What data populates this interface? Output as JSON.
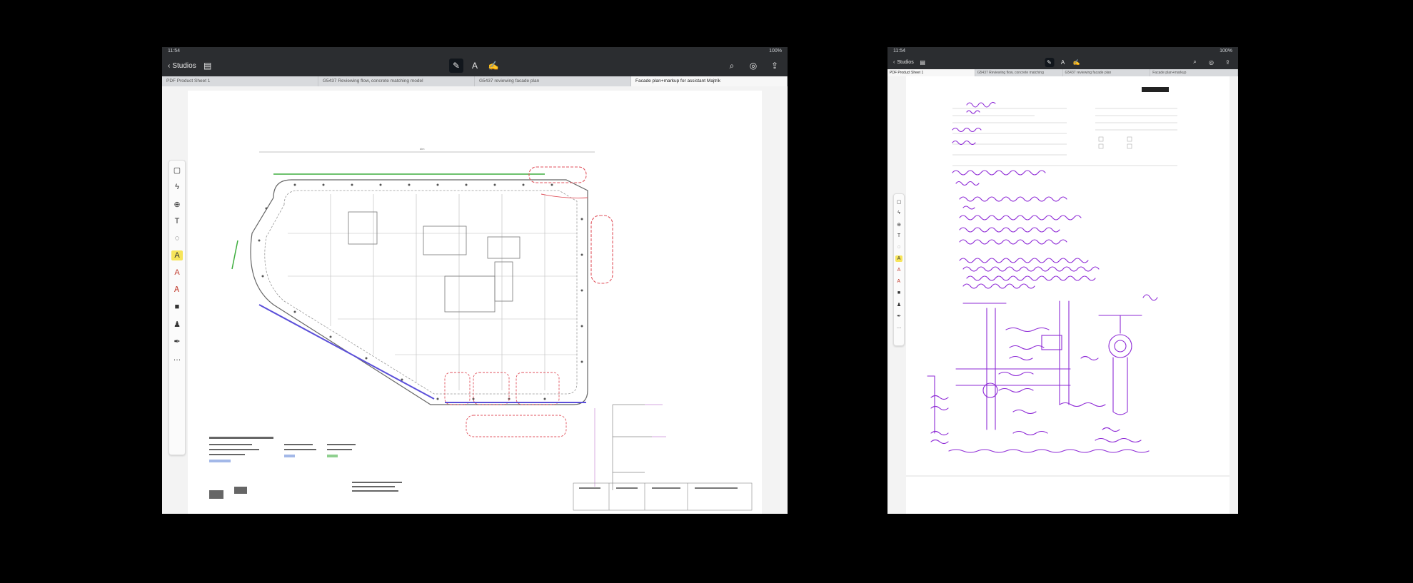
{
  "left_device": {
    "nav": {
      "back_label": "Studios"
    },
    "tabs": [
      {
        "label": "PDF Product Sheet 1",
        "active": false
      },
      {
        "label": "G5437 Reviewing flow, concrete matching model",
        "active": false
      },
      {
        "label": "G5437 reviewing facade plan",
        "active": false
      },
      {
        "label": "Facade plan+markup for assistant Majtrik",
        "active": true
      }
    ],
    "toolbar_icons": [
      "pen-icon",
      "highlighter-icon",
      "note-icon",
      "search-icon",
      "glasses-icon",
      "share-icon"
    ],
    "side_tools": [
      "select-icon",
      "lightning-icon",
      "zoom-icon",
      "text-icon",
      "shape-icon",
      "highlight-icon",
      "stamp-icon",
      "pencil-icon",
      "camera-icon",
      "person-icon",
      "marker-icon",
      "more-icon"
    ],
    "colors": {
      "green_markup": "#3fae3f",
      "red_markup": "#e0525c",
      "blue_markup": "#5b4fd9",
      "plan_line": "#555555",
      "toolbar_bg": "#2b2d30"
    }
  },
  "right_device": {
    "nav": {
      "back_label": "Studios"
    },
    "tabs": [
      {
        "label": "PDF Product Sheet 1",
        "active": true
      },
      {
        "label": "G5437 Reviewing flow, concrete matching",
        "active": false
      },
      {
        "label": "G5437 reviewing facade plan",
        "active": false
      },
      {
        "label": "Facade plan+markup",
        "active": false
      }
    ],
    "toolbar_icons": [
      "pen-icon",
      "highlighter-icon",
      "note-icon",
      "search-icon",
      "glasses-icon",
      "share-icon"
    ],
    "side_tools": [
      "select-icon",
      "lightning-icon",
      "zoom-icon",
      "text-icon",
      "shape-icon",
      "highlight-icon",
      "stamp-icon",
      "pencil-icon",
      "camera-icon",
      "person-icon",
      "marker-icon",
      "more-icon"
    ],
    "colors": {
      "handwriting": "#8e2ad6"
    }
  }
}
